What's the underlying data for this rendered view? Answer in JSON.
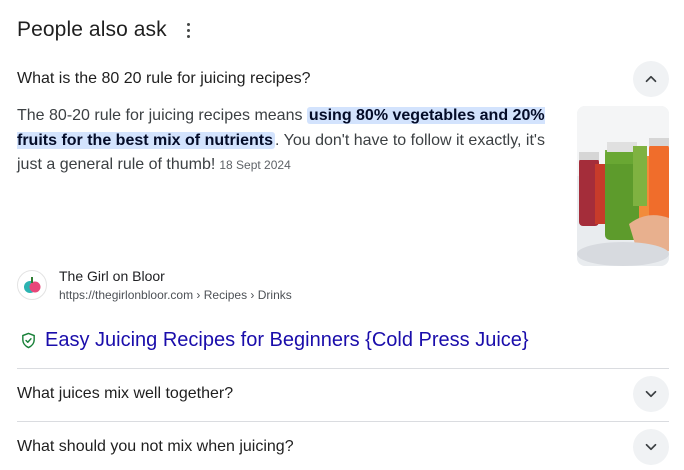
{
  "header": {
    "title": "People also ask"
  },
  "expanded": {
    "question": "What is the 80 20 rule for juicing recipes?",
    "answer_before": "The 80-20 rule for juicing recipes means ",
    "answer_highlight": "using 80% vegetables and 20% fruits for the best mix of nutrients",
    "answer_after": ". You don't have to follow it exactly, it's just a general rule of thumb!",
    "date": "18 Sept 2024",
    "source": {
      "name": "The Girl on Bloor",
      "url": "https://thegirlonbloor.com › Recipes › Drinks"
    },
    "result_title": "Easy Juicing Recipes for Beginners {Cold Press Juice}"
  },
  "questions": [
    {
      "label": "What juices mix well together?"
    },
    {
      "label": "What should you not mix when juicing?"
    }
  ],
  "colors": {
    "link": "#1a0dab",
    "highlight": "#d3e3fd",
    "verified": "#188038"
  },
  "icons": [
    "more-vert-icon",
    "chevron-up-icon",
    "chevron-down-icon",
    "verified-shield-icon",
    "site-favicon-icon"
  ]
}
